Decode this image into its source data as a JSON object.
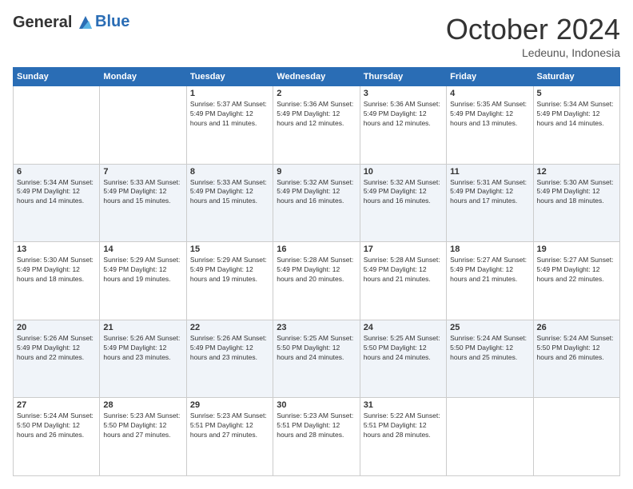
{
  "header": {
    "logo": {
      "line1": "General",
      "line2": "Blue"
    },
    "month_title": "October 2024",
    "location": "Ledeunu, Indonesia"
  },
  "weekdays": [
    "Sunday",
    "Monday",
    "Tuesday",
    "Wednesday",
    "Thursday",
    "Friday",
    "Saturday"
  ],
  "weeks": [
    [
      {
        "day": "",
        "info": ""
      },
      {
        "day": "",
        "info": ""
      },
      {
        "day": "1",
        "info": "Sunrise: 5:37 AM\nSunset: 5:49 PM\nDaylight: 12 hours and 11 minutes."
      },
      {
        "day": "2",
        "info": "Sunrise: 5:36 AM\nSunset: 5:49 PM\nDaylight: 12 hours and 12 minutes."
      },
      {
        "day": "3",
        "info": "Sunrise: 5:36 AM\nSunset: 5:49 PM\nDaylight: 12 hours and 12 minutes."
      },
      {
        "day": "4",
        "info": "Sunrise: 5:35 AM\nSunset: 5:49 PM\nDaylight: 12 hours and 13 minutes."
      },
      {
        "day": "5",
        "info": "Sunrise: 5:34 AM\nSunset: 5:49 PM\nDaylight: 12 hours and 14 minutes."
      }
    ],
    [
      {
        "day": "6",
        "info": "Sunrise: 5:34 AM\nSunset: 5:49 PM\nDaylight: 12 hours and 14 minutes."
      },
      {
        "day": "7",
        "info": "Sunrise: 5:33 AM\nSunset: 5:49 PM\nDaylight: 12 hours and 15 minutes."
      },
      {
        "day": "8",
        "info": "Sunrise: 5:33 AM\nSunset: 5:49 PM\nDaylight: 12 hours and 15 minutes."
      },
      {
        "day": "9",
        "info": "Sunrise: 5:32 AM\nSunset: 5:49 PM\nDaylight: 12 hours and 16 minutes."
      },
      {
        "day": "10",
        "info": "Sunrise: 5:32 AM\nSunset: 5:49 PM\nDaylight: 12 hours and 16 minutes."
      },
      {
        "day": "11",
        "info": "Sunrise: 5:31 AM\nSunset: 5:49 PM\nDaylight: 12 hours and 17 minutes."
      },
      {
        "day": "12",
        "info": "Sunrise: 5:30 AM\nSunset: 5:49 PM\nDaylight: 12 hours and 18 minutes."
      }
    ],
    [
      {
        "day": "13",
        "info": "Sunrise: 5:30 AM\nSunset: 5:49 PM\nDaylight: 12 hours and 18 minutes."
      },
      {
        "day": "14",
        "info": "Sunrise: 5:29 AM\nSunset: 5:49 PM\nDaylight: 12 hours and 19 minutes."
      },
      {
        "day": "15",
        "info": "Sunrise: 5:29 AM\nSunset: 5:49 PM\nDaylight: 12 hours and 19 minutes."
      },
      {
        "day": "16",
        "info": "Sunrise: 5:28 AM\nSunset: 5:49 PM\nDaylight: 12 hours and 20 minutes."
      },
      {
        "day": "17",
        "info": "Sunrise: 5:28 AM\nSunset: 5:49 PM\nDaylight: 12 hours and 21 minutes."
      },
      {
        "day": "18",
        "info": "Sunrise: 5:27 AM\nSunset: 5:49 PM\nDaylight: 12 hours and 21 minutes."
      },
      {
        "day": "19",
        "info": "Sunrise: 5:27 AM\nSunset: 5:49 PM\nDaylight: 12 hours and 22 minutes."
      }
    ],
    [
      {
        "day": "20",
        "info": "Sunrise: 5:26 AM\nSunset: 5:49 PM\nDaylight: 12 hours and 22 minutes."
      },
      {
        "day": "21",
        "info": "Sunrise: 5:26 AM\nSunset: 5:49 PM\nDaylight: 12 hours and 23 minutes."
      },
      {
        "day": "22",
        "info": "Sunrise: 5:26 AM\nSunset: 5:49 PM\nDaylight: 12 hours and 23 minutes."
      },
      {
        "day": "23",
        "info": "Sunrise: 5:25 AM\nSunset: 5:50 PM\nDaylight: 12 hours and 24 minutes."
      },
      {
        "day": "24",
        "info": "Sunrise: 5:25 AM\nSunset: 5:50 PM\nDaylight: 12 hours and 24 minutes."
      },
      {
        "day": "25",
        "info": "Sunrise: 5:24 AM\nSunset: 5:50 PM\nDaylight: 12 hours and 25 minutes."
      },
      {
        "day": "26",
        "info": "Sunrise: 5:24 AM\nSunset: 5:50 PM\nDaylight: 12 hours and 26 minutes."
      }
    ],
    [
      {
        "day": "27",
        "info": "Sunrise: 5:24 AM\nSunset: 5:50 PM\nDaylight: 12 hours and 26 minutes."
      },
      {
        "day": "28",
        "info": "Sunrise: 5:23 AM\nSunset: 5:50 PM\nDaylight: 12 hours and 27 minutes."
      },
      {
        "day": "29",
        "info": "Sunrise: 5:23 AM\nSunset: 5:51 PM\nDaylight: 12 hours and 27 minutes."
      },
      {
        "day": "30",
        "info": "Sunrise: 5:23 AM\nSunset: 5:51 PM\nDaylight: 12 hours and 28 minutes."
      },
      {
        "day": "31",
        "info": "Sunrise: 5:22 AM\nSunset: 5:51 PM\nDaylight: 12 hours and 28 minutes."
      },
      {
        "day": "",
        "info": ""
      },
      {
        "day": "",
        "info": ""
      }
    ]
  ]
}
